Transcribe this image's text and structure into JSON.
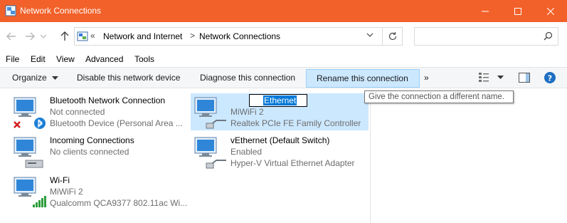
{
  "window": {
    "title": "Network Connections",
    "accent": "#f2612a"
  },
  "address": {
    "overflow": "«",
    "crumbs": [
      "Network and Internet",
      "Network Connections"
    ],
    "separator": ">",
    "search_placeholder": ""
  },
  "menu": {
    "items": [
      {
        "key": "F",
        "rest": "ile"
      },
      {
        "key": "E",
        "rest": "dit"
      },
      {
        "key": "V",
        "rest": "iew"
      },
      {
        "key": "",
        "rest": "Advanced",
        "key2": "A"
      },
      {
        "key": "T",
        "rest": "ools"
      }
    ],
    "file": "File",
    "edit": "Edit",
    "view": "View",
    "advanced": "Advanced",
    "tools": "Tools"
  },
  "commands": {
    "organize": "Organize",
    "disable": "Disable this network device",
    "diagnose": "Diagnose this connection",
    "rename": "Rename this connection",
    "more": "»"
  },
  "tooltip": "Give the connection a different name.",
  "rename_value": "Ethernet",
  "connections": [
    {
      "name": "Bluetooth Network Connection",
      "status": "Not connected",
      "device": "Bluetooth Device (Personal Area ..."
    },
    {
      "name": "Incoming Connections",
      "status": "No clients connected",
      "device": ""
    },
    {
      "name": "Wi-Fi",
      "status": "MiWiFi 2",
      "device": "Qualcomm QCA9377 802.11ac Wi..."
    },
    {
      "name": "Ethernet",
      "status": "MiWiFi 2",
      "device": "Realtek PCIe FE Family Controller"
    },
    {
      "name": "vEthernet (Default Switch)",
      "status": "Enabled",
      "device": "Hyper-V Virtual Ethernet Adapter"
    }
  ]
}
